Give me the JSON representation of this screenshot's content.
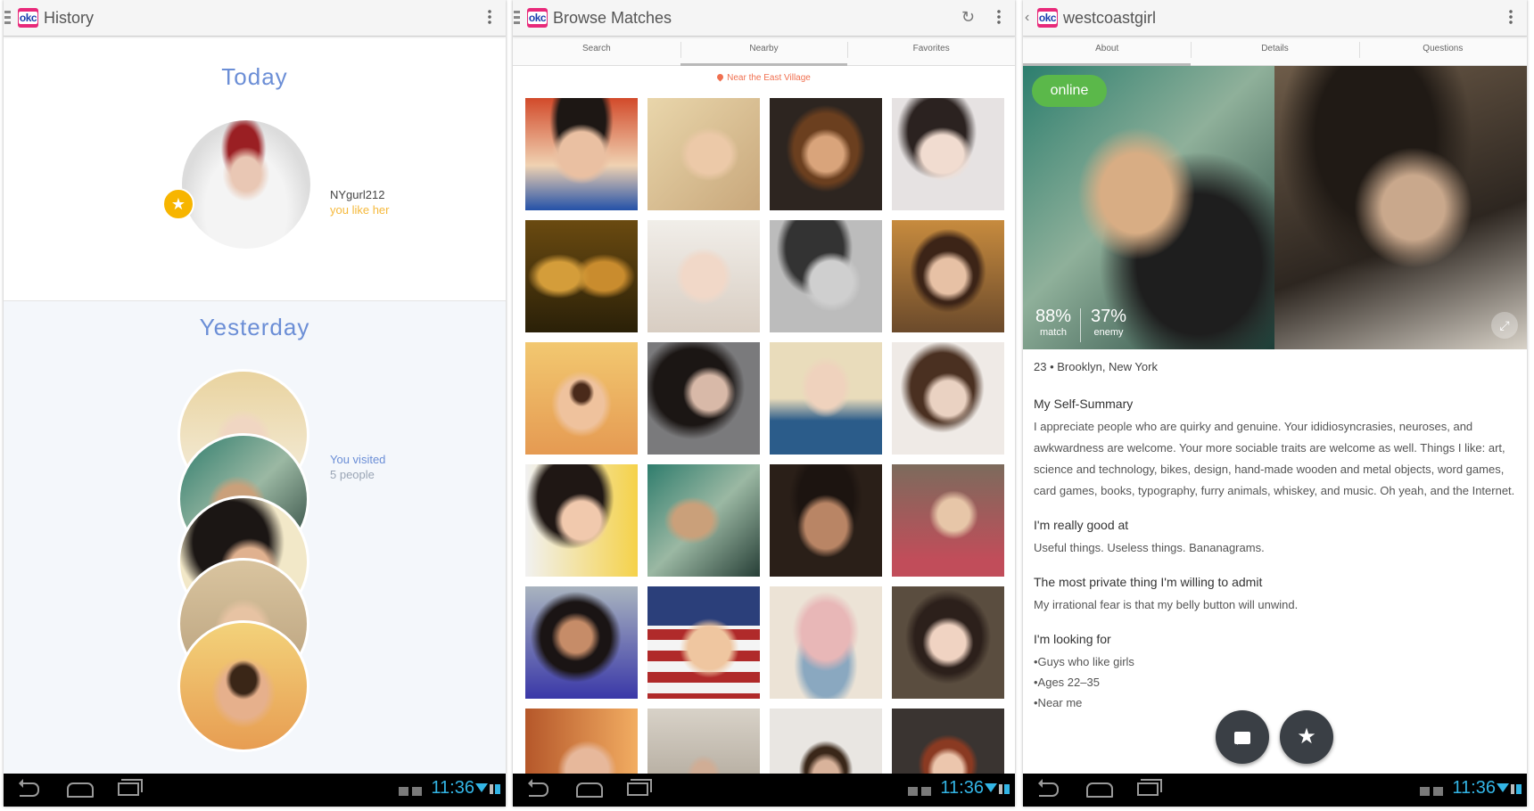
{
  "panels": {
    "history": {
      "title": "History",
      "today_heading": "Today",
      "today_entry": {
        "username": "NYgurl212",
        "status": "you like her",
        "badge_icon": "star-icon"
      },
      "yesterday_heading": "Yesterday",
      "yesterday_entry": {
        "label": "You visited",
        "count_text": "5 people"
      }
    },
    "browse": {
      "title": "Browse Matches",
      "tabs": [
        "Search",
        "Nearby",
        "Favorites"
      ],
      "active_tab": "Nearby",
      "location": "Near the East Village"
    },
    "profile": {
      "title": "westcoastgirl",
      "tabs": [
        "About",
        "Details",
        "Questions"
      ],
      "active_tab": "About",
      "online": "online",
      "match_pct": "88%",
      "match_label": "match",
      "enemy_pct": "37%",
      "enemy_label": "enemy",
      "meta": "23 • Brooklyn, New York",
      "sections": [
        {
          "heading": "My Self-Summary",
          "body": "I appreciate people who are quirky and genuine. Your ididiosyncrasies, neuroses, and awkwardness are welcome. Your more sociable traits are welcome as well. Things I like: art, science and technology, bikes, design, hand-made wooden and metal objects, word games, card games, books, typography, furry animals, whiskey, and music. Oh yeah, and the Internet."
        },
        {
          "heading": "I'm really good at",
          "body": "Useful things. Useless things. Bananagrams."
        },
        {
          "heading": "The most private thing I'm willing to admit",
          "body": "My irrational fear is that my belly button will unwind."
        },
        {
          "heading": "I'm looking for",
          "lines": [
            "•Guys who like girls",
            "•Ages 22–35",
            "•Near me"
          ]
        }
      ]
    }
  },
  "system_bar": {
    "time": "11:36"
  },
  "colors": {
    "okc_pink": "#e8297a",
    "heading_blue": "#6b8ed6",
    "like_yellow": "#f5b93c",
    "online_green": "#5bb84a",
    "clock_blue": "#33b5e5",
    "location_orange": "#f07050"
  }
}
